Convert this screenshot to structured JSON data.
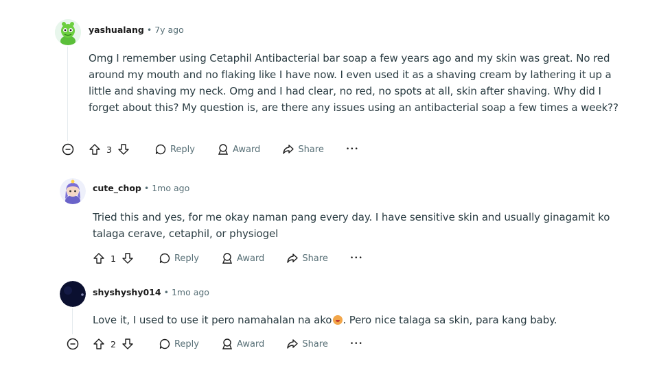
{
  "comments": [
    {
      "author": "yashualang",
      "sep": "•",
      "age": "7y ago",
      "body": "Omg I remember using Cetaphil Antibacterial bar soap a few years ago and my skin was great. No red around my mouth and no flaking like I have now. I even used it as a shaving cream by lathering it up a little and shaving my neck. Omg and I had clear, no red, no spots at all, skin after shaving. Why did I forget about this? My question is, are there any issues using an antibacterial soap a few times a week??",
      "votes": "3",
      "reply": "Reply",
      "award": "Award",
      "share": "Share",
      "more": "•••"
    },
    {
      "author": "cute_chop",
      "sep": "•",
      "age": "1mo ago",
      "body": "Tried this and yes, for me okay naman pang every day. I have sensitive skin and usually ginagamit ko talaga cerave, cetaphil, or physiogel",
      "votes": "1",
      "reply": "Reply",
      "award": "Award",
      "share": "Share",
      "more": "•••"
    },
    {
      "author": "shyshyshy014",
      "sep": "•",
      "age": "1mo ago",
      "body_before": "Love it, I used to use it pero namahalan na ako",
      "body_after": ". Pero nice talaga sa skin, para kang baby.",
      "emoji": "flushed-face-emoji",
      "votes": "2",
      "reply": "Reply",
      "award": "Award",
      "share": "Share",
      "more": "•••"
    }
  ],
  "colors": {
    "text": "#1c1c1c",
    "meta": "#576f76",
    "body": "#2a3c42",
    "thread_line": "#e5ebee"
  },
  "icons": [
    "collapse-icon",
    "upvote-icon",
    "downvote-icon",
    "reply-icon",
    "award-icon",
    "share-icon",
    "more-icon"
  ]
}
